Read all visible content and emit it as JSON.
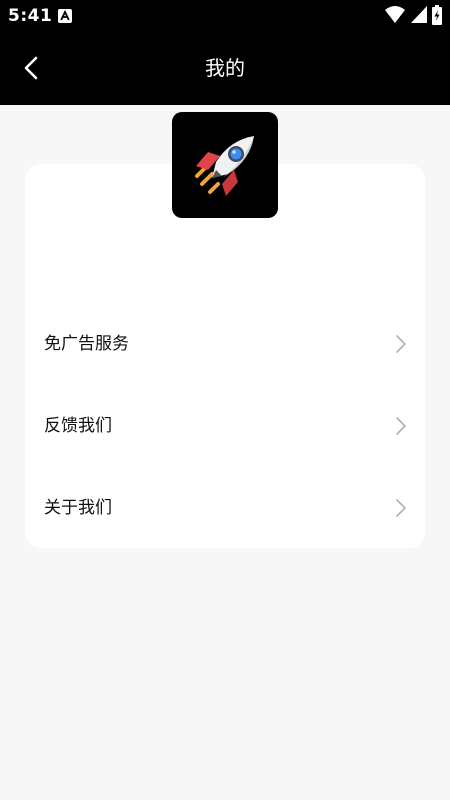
{
  "status_bar": {
    "time": "5:41",
    "notification_icon": "a-letter-icon",
    "icons": [
      "wifi-icon",
      "cellular-signal-icon",
      "battery-charging-icon"
    ]
  },
  "header": {
    "title": "我的",
    "back_icon": "chevron-left-icon"
  },
  "profile": {
    "app_icon": "rocket-icon"
  },
  "menu": {
    "items": [
      {
        "label": "免广告服务",
        "icon": "chevron-right-icon"
      },
      {
        "label": "反馈我们",
        "icon": "chevron-right-icon"
      },
      {
        "label": "关于我们",
        "icon": "chevron-right-icon"
      }
    ]
  },
  "colors": {
    "header_bg": "#000000",
    "page_bg": "#f7f7f7",
    "card_bg": "#ffffff",
    "chevron": "#b0b0b0"
  }
}
